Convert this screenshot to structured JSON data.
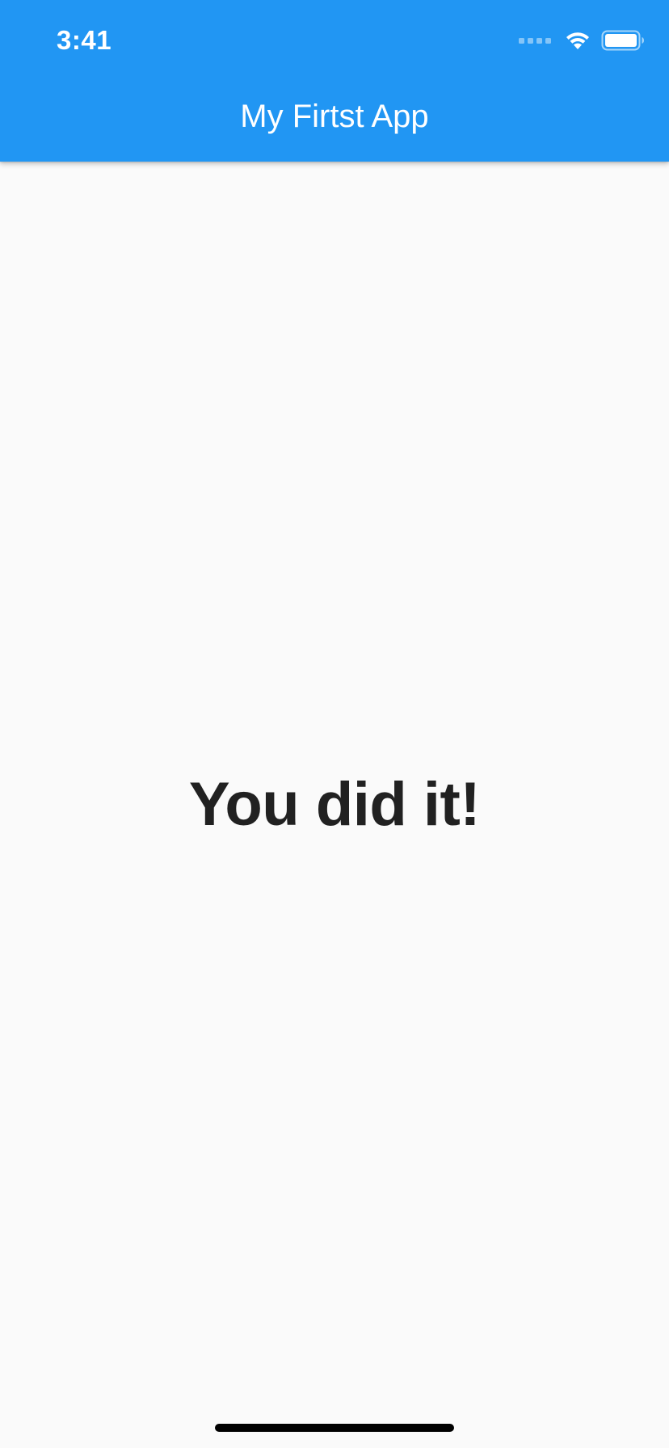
{
  "status_bar": {
    "time": "3:41",
    "icons": [
      "cellular-signal-icon",
      "wifi-icon",
      "battery-icon"
    ]
  },
  "app_bar": {
    "title": "My Firtst App",
    "color": "#2196f3"
  },
  "main": {
    "message": "You did it!"
  },
  "colors": {
    "background": "#fafafa",
    "text": "#212121",
    "appbar_text": "#ffffff"
  }
}
